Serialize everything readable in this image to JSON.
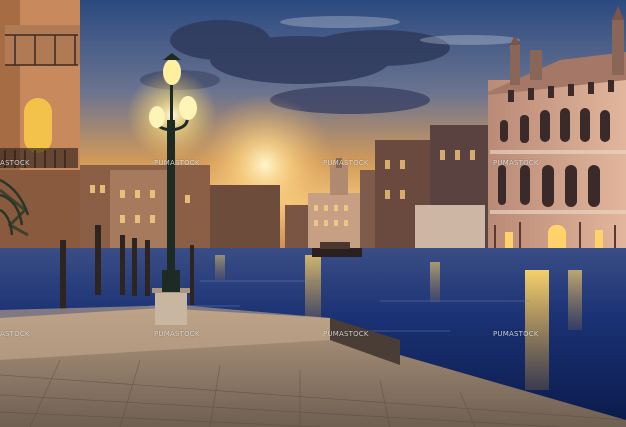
{
  "watermark": {
    "text_full": "PUMASTOCK",
    "text_clipped": "ASTOCK"
  },
  "colors": {
    "sky_top": "#2d4a7e",
    "sky_mid": "#c98a4e",
    "sun_glow": "#ffe9a8",
    "water_deep": "#0c1f52",
    "lamp_light": "#fff3b0",
    "building_warm": "#d9a27a",
    "pavement": "#8c7b69"
  },
  "icons": {
    "lamp": "street-lamp-icon"
  }
}
